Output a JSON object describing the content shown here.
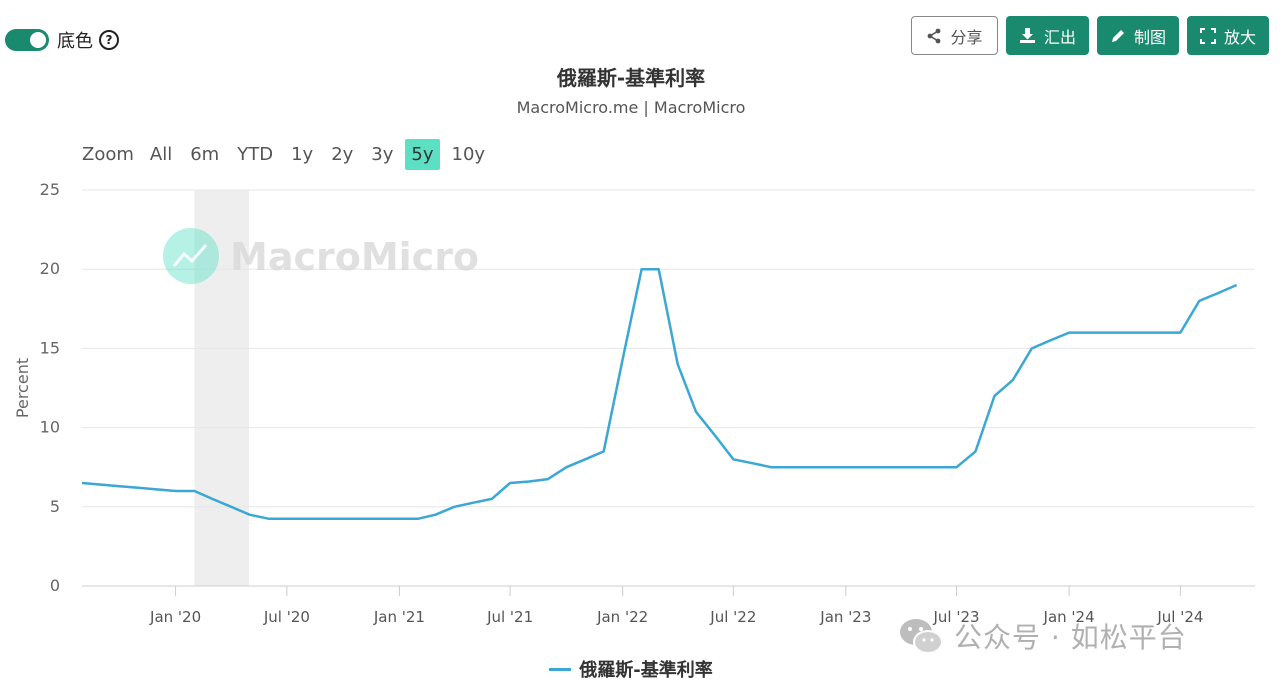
{
  "toolbar": {
    "toggle_label": "底色",
    "help_glyph": "?",
    "share_label": "分享",
    "export_label": "汇出",
    "draw_label": "制图",
    "expand_label": "放大",
    "accent_color": "#1a8a6e"
  },
  "header": {
    "title": "俄羅斯-基準利率",
    "subtitle": "MacroMicro.me | MacroMicro"
  },
  "range_selector": {
    "label": "Zoom",
    "options": [
      "All",
      "6m",
      "YTD",
      "1y",
      "2y",
      "3y",
      "5y",
      "10y"
    ],
    "selected": "5y",
    "selected_color": "#5ce0c3"
  },
  "watermark": {
    "chart_logo_text": "MacroMicro",
    "wechat_text": "公众号 · 如松平台"
  },
  "chart_data": {
    "type": "line",
    "title": "俄羅斯-基準利率",
    "subtitle": "MacroMicro.me | MacroMicro",
    "xlabel": "",
    "ylabel": "Percent",
    "ylim": [
      0,
      25
    ],
    "y_ticks": [
      0,
      5,
      10,
      15,
      20,
      25
    ],
    "x_range": [
      "2019-08-01",
      "2024-10-31"
    ],
    "x_ticks": [
      {
        "date": "2020-01-01",
        "label": "Jan '20"
      },
      {
        "date": "2020-07-01",
        "label": "Jul '20"
      },
      {
        "date": "2021-01-01",
        "label": "Jan '21"
      },
      {
        "date": "2021-07-01",
        "label": "Jul '21"
      },
      {
        "date": "2022-01-01",
        "label": "Jan '22"
      },
      {
        "date": "2022-07-01",
        "label": "Jul '22"
      },
      {
        "date": "2023-01-01",
        "label": "Jan '23"
      },
      {
        "date": "2023-07-01",
        "label": "Jul '23"
      },
      {
        "date": "2024-01-01",
        "label": "Jan '24"
      },
      {
        "date": "2024-07-01",
        "label": "Jul '24"
      }
    ],
    "grid": true,
    "legend": "bottom",
    "shaded_period": {
      "start": "2020-02-01",
      "end": "2020-04-30",
      "color": "#eeeeee"
    },
    "series": [
      {
        "name": "俄羅斯-基準利率",
        "color": "#3aa7d4",
        "x": [
          "2019-08-01",
          "2019-09-01",
          "2019-10-01",
          "2019-11-01",
          "2019-12-01",
          "2020-01-01",
          "2020-02-01",
          "2020-03-01",
          "2020-04-01",
          "2020-05-01",
          "2020-06-01",
          "2020-07-01",
          "2020-08-01",
          "2020-12-01",
          "2021-01-01",
          "2021-02-01",
          "2021-03-01",
          "2021-04-01",
          "2021-05-01",
          "2021-06-01",
          "2021-07-01",
          "2021-08-01",
          "2021-09-01",
          "2021-10-01",
          "2021-11-01",
          "2021-12-01",
          "2022-01-01",
          "2022-02-01",
          "2022-03-01",
          "2022-04-01",
          "2022-05-01",
          "2022-06-01",
          "2022-07-01",
          "2022-08-01",
          "2022-09-01",
          "2022-12-01",
          "2023-03-01",
          "2023-06-01",
          "2023-07-01",
          "2023-08-01",
          "2023-09-01",
          "2023-10-01",
          "2023-11-01",
          "2023-12-01",
          "2024-01-01",
          "2024-04-01",
          "2024-06-01",
          "2024-07-01",
          "2024-08-01",
          "2024-09-01",
          "2024-10-01"
        ],
        "y": [
          6.5,
          6.4,
          6.3,
          6.2,
          6.1,
          6.0,
          6.0,
          5.5,
          5.0,
          4.5,
          4.25,
          4.25,
          4.25,
          4.25,
          4.25,
          4.25,
          4.5,
          5.0,
          5.25,
          5.5,
          6.5,
          6.6,
          6.75,
          7.5,
          8.0,
          8.5,
          14.3,
          20.0,
          20.0,
          14.0,
          11.0,
          9.5,
          8.0,
          7.75,
          7.5,
          7.5,
          7.5,
          7.5,
          7.5,
          8.5,
          12.0,
          13.0,
          15.0,
          15.5,
          16.0,
          16.0,
          16.0,
          16.0,
          18.0,
          18.5,
          19.0
        ]
      }
    ]
  }
}
